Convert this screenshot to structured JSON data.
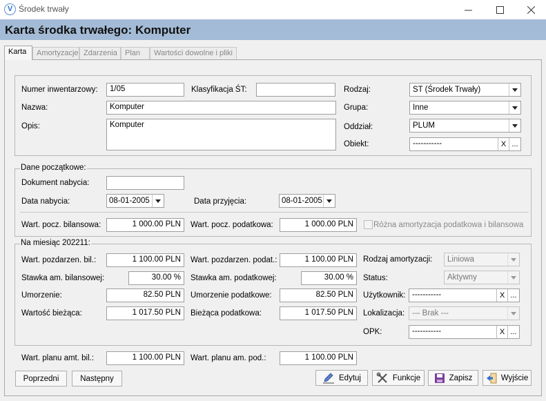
{
  "window": {
    "title": "Środek trwały",
    "app_icon": "V"
  },
  "header": {
    "title": "Karta środka trwałego: Komputer"
  },
  "tabs": [
    "Karta",
    "Amortyzacje",
    "Zdarzenia",
    "Plan",
    "Wartości dowolne i pliki"
  ],
  "basic": {
    "inv_label": "Numer inwentarzowy:",
    "inv_value": "1/05",
    "klas_label": "Klasyfikacja ŚT:",
    "klas_value": "",
    "nazwa_label": "Nazwa:",
    "nazwa_value": "Komputer",
    "opis_label": "Opis:",
    "opis_value": "Komputer",
    "rodzaj_label": "Rodzaj:",
    "rodzaj_value": "ST (Środek Trwały)",
    "grupa_label": "Grupa:",
    "grupa_value": "Inne",
    "oddzial_label": "Oddział:",
    "oddzial_value": "PLUM",
    "obiekt_label": "Obiekt:",
    "obiekt_value": "-----------"
  },
  "initial": {
    "legend": "Dane początkowe:",
    "dok_label": "Dokument nabycia:",
    "dok_value": "",
    "data_nab_label": "Data nabycia:",
    "data_nab_value": "08-01-2005",
    "data_prz_label": "Data przyjęcia:",
    "data_prz_value": "08-01-2005",
    "bil_label": "Wart. pocz. bilansowa:",
    "bil_value": "1 000.00 PLN",
    "pod_label": "Wart. pocz. podatkowa:",
    "pod_value": "1 000.00 PLN",
    "diff_label": "Różna amortyzacja podatkowa i bilansowa"
  },
  "monthly": {
    "legend": "Na miesiąc 202211:",
    "pozb_label": "Wart. pozdarzen. bil.:",
    "pozb_value": "1 100.00 PLN",
    "pozp_label": "Wart. pozdarzen. podat.:",
    "pozp_value": "1 100.00 PLN",
    "stb_label": "Stawka am. bilansowej:",
    "stb_value": "30.00 %",
    "stp_label": "Stawka am. podatkowej:",
    "stp_value": "30.00 %",
    "um_label": "Umorzenie:",
    "um_value": "82.50 PLN",
    "ump_label": "Umorzenie podatkowe:",
    "ump_value": "82.50 PLN",
    "wb_label": "Wartość bieżąca:",
    "wb_value": "1 017.50 PLN",
    "bp_label": "Bieżąca podatkowa:",
    "bp_value": "1 017.50 PLN",
    "ra_label": "Rodzaj amortyzacji:",
    "ra_value": "Liniowa",
    "status_label": "Status:",
    "status_value": "Aktywny",
    "user_label": "Użytkownik:",
    "user_value": "-----------",
    "lok_label": "Lokalizacja:",
    "lok_value": "--- Brak ---",
    "opk_label": "OPK:",
    "opk_value": "-----------"
  },
  "plan": {
    "bil_label": "Wart. planu amt. bil.:",
    "bil_value": "1 100.00 PLN",
    "pod_label": "Wart. planu am. pod.:",
    "pod_value": "1 100.00 PLN"
  },
  "buttons": {
    "prev": "Poprzedni",
    "next": "Następny",
    "edit": "Edytuj",
    "func": "Funkcje",
    "save": "Zapisz",
    "exit": "Wyjście",
    "clear": "X",
    "dots": "..."
  }
}
